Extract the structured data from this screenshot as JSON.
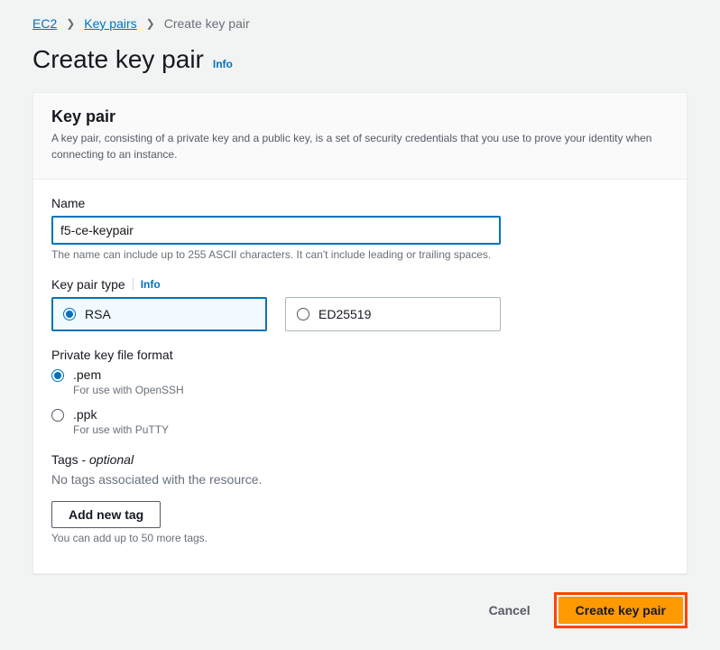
{
  "breadcrumb": {
    "items": [
      {
        "label": "EC2",
        "link": true
      },
      {
        "label": "Key pairs",
        "link": true
      },
      {
        "label": "Create key pair",
        "link": false
      }
    ]
  },
  "page": {
    "title": "Create key pair",
    "info_label": "Info"
  },
  "panel": {
    "title": "Key pair",
    "description": "A key pair, consisting of a private key and a public key, is a set of security credentials that you use to prove your identity when connecting to an instance."
  },
  "name_field": {
    "label": "Name",
    "value": "f5-ce-keypair",
    "hint": "The name can include up to 255 ASCII characters. It can't include leading or trailing spaces."
  },
  "type_field": {
    "label": "Key pair type",
    "info_label": "Info",
    "options": [
      {
        "label": "RSA",
        "selected": true
      },
      {
        "label": "ED25519",
        "selected": false
      }
    ]
  },
  "format_field": {
    "label": "Private key file format",
    "options": [
      {
        "label": ".pem",
        "sub": "For use with OpenSSH",
        "selected": true
      },
      {
        "label": ".ppk",
        "sub": "For use with PuTTY",
        "selected": false
      }
    ]
  },
  "tags": {
    "label_main": "Tags - ",
    "label_optional": "optional",
    "empty_text": "No tags associated with the resource.",
    "add_button": "Add new tag",
    "limit_hint": "You can add up to 50 more tags."
  },
  "actions": {
    "cancel": "Cancel",
    "submit": "Create key pair"
  }
}
